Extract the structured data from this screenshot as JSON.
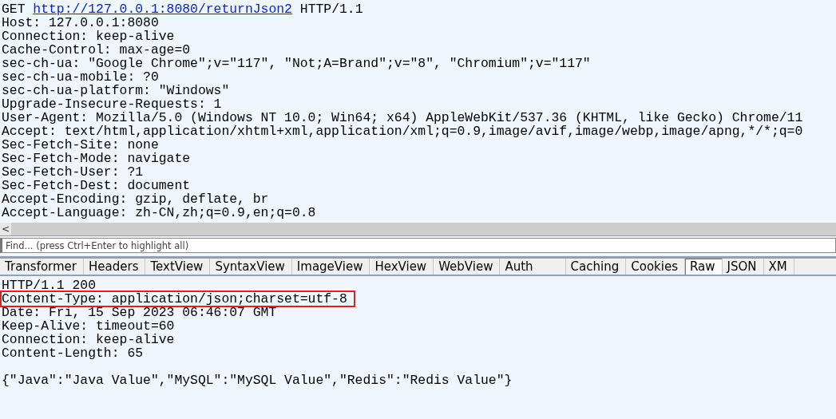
{
  "request": {
    "method": "GET",
    "url": "http://127.0.0.1:8080/returnJson2",
    "protocol": "HTTP/1.1",
    "headers": [
      "Host: 127.0.0.1:8080",
      "Connection: keep-alive",
      "Cache-Control: max-age=0",
      "sec-ch-ua: \"Google Chrome\";v=\"117\", \"Not;A=Brand\";v=\"8\", \"Chromium\";v=\"117\"",
      "sec-ch-ua-mobile: ?0",
      "sec-ch-ua-platform: \"Windows\"",
      "Upgrade-Insecure-Requests: 1",
      "User-Agent: Mozilla/5.0 (Windows NT 10.0; Win64; x64) AppleWebKit/537.36 (KHTML, like Gecko) Chrome/11",
      "Accept: text/html,application/xhtml+xml,application/xml;q=0.9,image/avif,image/webp,image/apng,*/*;q=0",
      "Sec-Fetch-Site: none",
      "Sec-Fetch-Mode: navigate",
      "Sec-Fetch-User: ?1",
      "Sec-Fetch-Dest: document",
      "Accept-Encoding: gzip, deflate, br",
      "Accept-Language: zh-CN,zh;q=0.9,en;q=0.8"
    ]
  },
  "scrollbar": {
    "left_arrow": "<"
  },
  "find": {
    "placeholder": "Find... (press Ctrl+Enter to highlight all)"
  },
  "tabs": [
    {
      "label": "Transformer",
      "selected": false
    },
    {
      "label": "Headers",
      "selected": false
    },
    {
      "label": "TextView",
      "selected": false
    },
    {
      "label": "SyntaxView",
      "selected": false
    },
    {
      "label": "ImageView",
      "selected": false
    },
    {
      "label": "HexView",
      "selected": false
    },
    {
      "label": "WebView",
      "selected": false
    },
    {
      "label": "Auth",
      "selected": false
    },
    {
      "label": "Caching",
      "selected": false
    },
    {
      "label": "Cookies",
      "selected": false
    },
    {
      "label": "Raw",
      "selected": true
    },
    {
      "label": "JSON",
      "selected": false
    },
    {
      "label": "XM",
      "selected": false
    }
  ],
  "response": {
    "lines": [
      {
        "text": "HTTP/1.1 200",
        "highlighted": false
      },
      {
        "text": "Content-Type: application/json;charset=utf-8",
        "highlighted": true
      },
      {
        "text": "Date: Fri, 15 Sep 2023 06:46:07 GMT",
        "highlighted": false
      },
      {
        "text": "Keep-Alive: timeout=60",
        "highlighted": false
      },
      {
        "text": "Connection: keep-alive",
        "highlighted": false
      },
      {
        "text": "Content-Length: 65",
        "highlighted": false
      }
    ],
    "body": "{\"Java\":\"Java Value\",\"MySQL\":\"MySQL Value\",\"Redis\":\"Redis Value\"}"
  }
}
